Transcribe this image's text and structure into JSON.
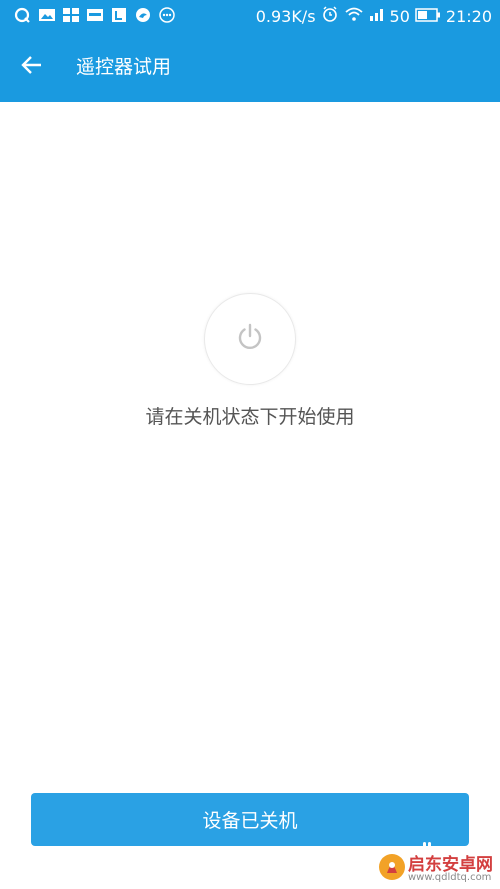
{
  "status_bar": {
    "net_speed": "0.93K/s",
    "battery_level": "50",
    "time": "21:20",
    "icons": [
      "qq-icon",
      "image-icon",
      "grid-icon",
      "news-icon",
      "app-l-icon",
      "bird-icon",
      "more-dots-icon",
      "alarm-icon",
      "wifi-icon",
      "signal-icon",
      "battery-icon"
    ]
  },
  "app_bar": {
    "title": "遥控器试用",
    "back_icon": "arrow-left-icon",
    "color": "#1a9ae0"
  },
  "main": {
    "power_icon": "power-icon",
    "hint": "请在关机状态下开始使用"
  },
  "footer": {
    "button_label": "设备已关机",
    "button_color": "#2aa1e4"
  },
  "watermark": {
    "brand": "启东安卓网",
    "url": "www.qdldtq.com"
  }
}
